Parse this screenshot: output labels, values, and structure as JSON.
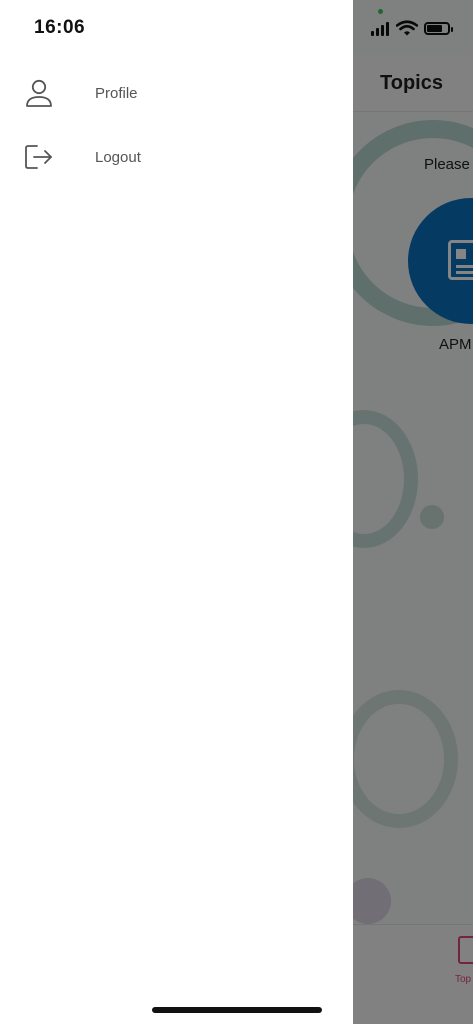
{
  "status_bar": {
    "time": "16:06"
  },
  "drawer": {
    "items": [
      {
        "label": "Profile",
        "icon": "person-icon"
      },
      {
        "label": "Logout",
        "icon": "logout-icon"
      }
    ]
  },
  "background_app": {
    "title": "Topics",
    "prompt_text": "Please",
    "topic_label": "APM",
    "tab_label": "Top",
    "colors": {
      "topic_circle": "#0a6fbf",
      "tab_accent": "#e0457b",
      "overlay": "rgba(0,0,0,0.48)"
    }
  }
}
